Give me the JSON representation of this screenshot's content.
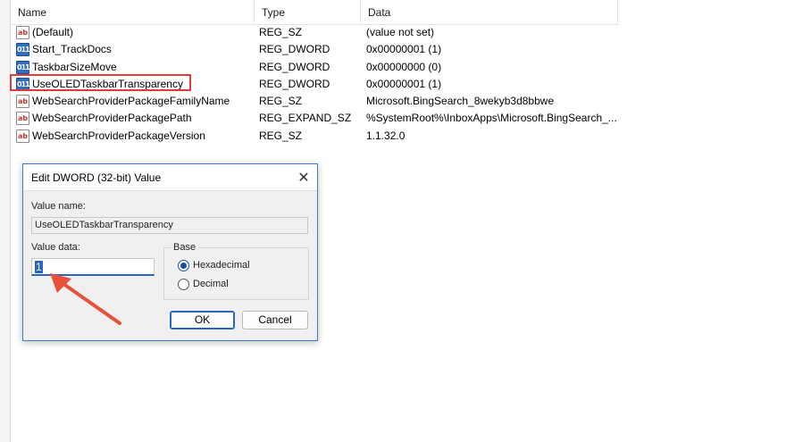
{
  "columns": {
    "name": "Name",
    "type": "Type",
    "data": "Data"
  },
  "rows": [
    {
      "icon": "ab",
      "icon_kind": "string-value-icon",
      "name": "(Default)",
      "type": "REG_SZ",
      "data": "(value not set)"
    },
    {
      "icon": "011",
      "icon_kind": "dword-value-icon",
      "name": "Start_TrackDocs",
      "type": "REG_DWORD",
      "data": "0x00000001 (1)"
    },
    {
      "icon": "011",
      "icon_kind": "dword-value-icon",
      "name": "TaskbarSizeMove",
      "type": "REG_DWORD",
      "data": "0x00000000 (0)"
    },
    {
      "icon": "011",
      "icon_kind": "dword-value-icon",
      "name": "UseOLEDTaskbarTransparency",
      "type": "REG_DWORD",
      "data": "0x00000001 (1)"
    },
    {
      "icon": "ab",
      "icon_kind": "string-value-icon",
      "name": "WebSearchProviderPackageFamilyName",
      "type": "REG_SZ",
      "data": "Microsoft.BingSearch_8wekyb3d8bbwe"
    },
    {
      "icon": "ab",
      "icon_kind": "string-value-icon",
      "name": "WebSearchProviderPackagePath",
      "type": "REG_EXPAND_SZ",
      "data": "%SystemRoot%\\InboxApps\\Microsoft.BingSearch_..."
    },
    {
      "icon": "ab",
      "icon_kind": "string-value-icon",
      "name": "WebSearchProviderPackageVersion",
      "type": "REG_SZ",
      "data": "1.1.32.0"
    }
  ],
  "dialog": {
    "title": "Edit DWORD (32-bit) Value",
    "close_glyph": "✕",
    "value_name_label": "Value name:",
    "value_name": "UseOLEDTaskbarTransparency",
    "value_data_label": "Value data:",
    "value_data": "1",
    "base_label": "Base",
    "base_options": [
      "Hexadecimal",
      "Decimal"
    ],
    "base_selected": "Hexadecimal",
    "ok_label": "OK",
    "cancel_label": "Cancel"
  },
  "colors": {
    "highlight_box": "#e03c3c",
    "arrow": "#e8503a",
    "accent": "#2b65c2"
  }
}
